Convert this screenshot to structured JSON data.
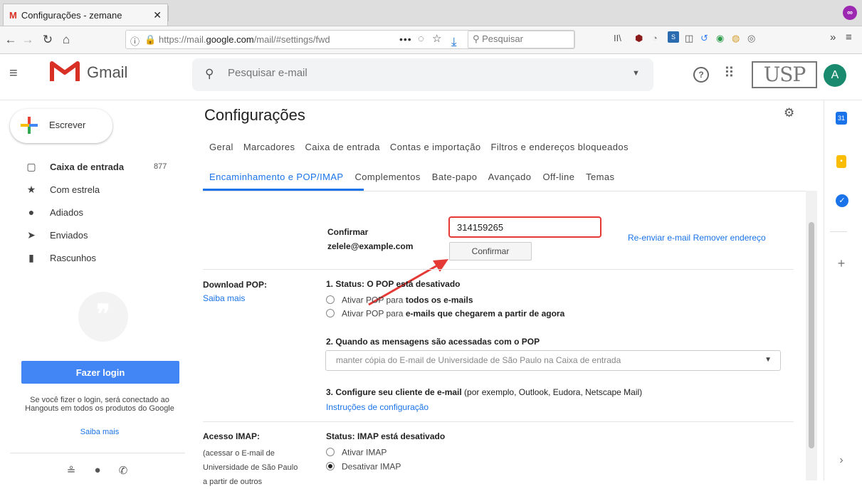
{
  "browser": {
    "tab_title": "Configurações - zemane",
    "tab_favicon": "M",
    "url_prefix": "https://mail.",
    "url_domain": "google.com",
    "url_rest": "/mail/#settings/fwda",
    "url_more": "•••",
    "search_placeholder": "Pesquisar",
    "toolbar_icons": [
      "library-icon",
      "ublock-icon",
      "clock-icon",
      "extension-icon",
      "reader-icon",
      "sync-icon",
      "green-circle-icon",
      "cookie-icon",
      "mask-icon",
      "overflow-icon",
      "menu-icon"
    ]
  },
  "gmail": {
    "app_name": "Gmail",
    "search_placeholder": "Pesquisar e-mail",
    "usp_logo": "USP",
    "avatar_letter": "A",
    "compose_label": "Escrever"
  },
  "sidebar": {
    "items": [
      {
        "label": "Caixa de entrada",
        "count": "877",
        "icon": "inbox-icon"
      },
      {
        "label": "Com estrela",
        "count": "",
        "icon": "star-icon"
      },
      {
        "label": "Adiados",
        "count": "",
        "icon": "clock-icon"
      },
      {
        "label": "Enviados",
        "count": "",
        "icon": "send-icon"
      },
      {
        "label": "Rascunhos",
        "count": "",
        "icon": "draft-icon"
      }
    ],
    "login_button": "Fazer login",
    "hangouts_text": "Se você fizer o login, será conectado ao Hangouts em todos os produtos do Google",
    "hangouts_link": "Saiba mais"
  },
  "settings": {
    "title": "Configurações",
    "tabs_row1": [
      "Geral",
      "Marcadores",
      "Caixa de entrada",
      "Contas e importação",
      "Filtros e endereços bloqueados"
    ],
    "tabs_row2": [
      "Encaminhamento e POP/IMAP",
      "Complementos",
      "Bate-papo",
      "Avançado",
      "Off-line",
      "Temas"
    ],
    "active_tab": "Encaminhamento e POP/IMAP",
    "confirm": {
      "label_line1": "Confirmar",
      "label_line2": "zelele@example.com",
      "code_value": "314159265",
      "button": "Confirmar",
      "resend_link": "Re-enviar e-mail",
      "remove_link": "Remover endereço"
    },
    "pop": {
      "label": "Download POP:",
      "learn_more": "Saiba mais",
      "status": "1. Status: O POP está desativado",
      "option1_prefix": "Ativar POP para ",
      "option1_bold": "todos os e-mails",
      "option2_prefix": "Ativar POP para ",
      "option2_bold": "e-mails que chegarem a partir de agora",
      "q2": "2. Quando as mensagens são acessadas com o POP",
      "select_value": "manter cópia do E-mail de Universidade de São Paulo na Caixa de entrada",
      "q3_bold": "3. Configure seu cliente de e-mail",
      "q3_rest": " (por exemplo, Outlook, Eudora, Netscape Mail)",
      "instructions_link": "Instruções de configuração"
    },
    "imap": {
      "label": "Acesso IMAP:",
      "sub_line1": "(acessar o E-mail de",
      "sub_line2": "Universidade de São Paulo",
      "sub_line3": "a partir de outros",
      "status": "Status: IMAP está desativado",
      "option_enable": "Ativar IMAP",
      "option_disable": "Desativar IMAP",
      "selected": "Desativar IMAP"
    }
  },
  "colors": {
    "accent": "#1a73e8",
    "highlight_box": "#e53935",
    "arrow": "#e53935",
    "avatar": "#1a8a6e"
  }
}
